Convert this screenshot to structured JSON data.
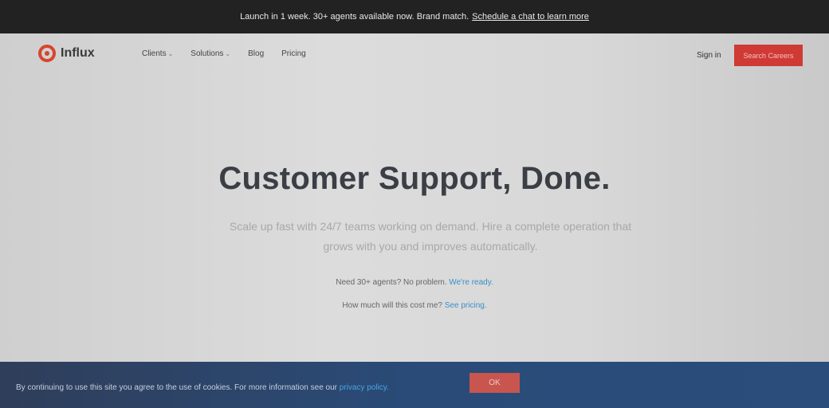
{
  "announcement": {
    "text": "Launch in 1 week. 30+ agents available now. Brand match.",
    "link": "Schedule a chat to learn more"
  },
  "nav": {
    "brand": "Influx",
    "links": [
      {
        "label": "Clients",
        "has_dropdown": true
      },
      {
        "label": "Solutions",
        "has_dropdown": true
      },
      {
        "label": "Blog",
        "has_dropdown": false
      },
      {
        "label": "Pricing",
        "has_dropdown": false
      }
    ],
    "signin": "Sign in",
    "cta": "Search Careers",
    "chevron": "⌄"
  },
  "hero": {
    "title": "Customer Support, Done.",
    "subtitle": "Scale up fast with 24/7 teams working on demand. Hire a complete operation that grows with you and improves automatically.",
    "line1": {
      "text": "Need 30+ agents? No problem.",
      "link": "We're ready."
    },
    "line2": {
      "text": "How much will this cost me?",
      "link": "See pricing."
    }
  },
  "cookie": {
    "text": "By continuing to use this site you agree to the use of cookies. For more information see our",
    "link": "privacy policy.",
    "ok": "OK"
  },
  "colors": {
    "brand_red": "#d03a34",
    "link_blue": "#3a8fc9",
    "cookie_bg": "#2a4b78"
  }
}
